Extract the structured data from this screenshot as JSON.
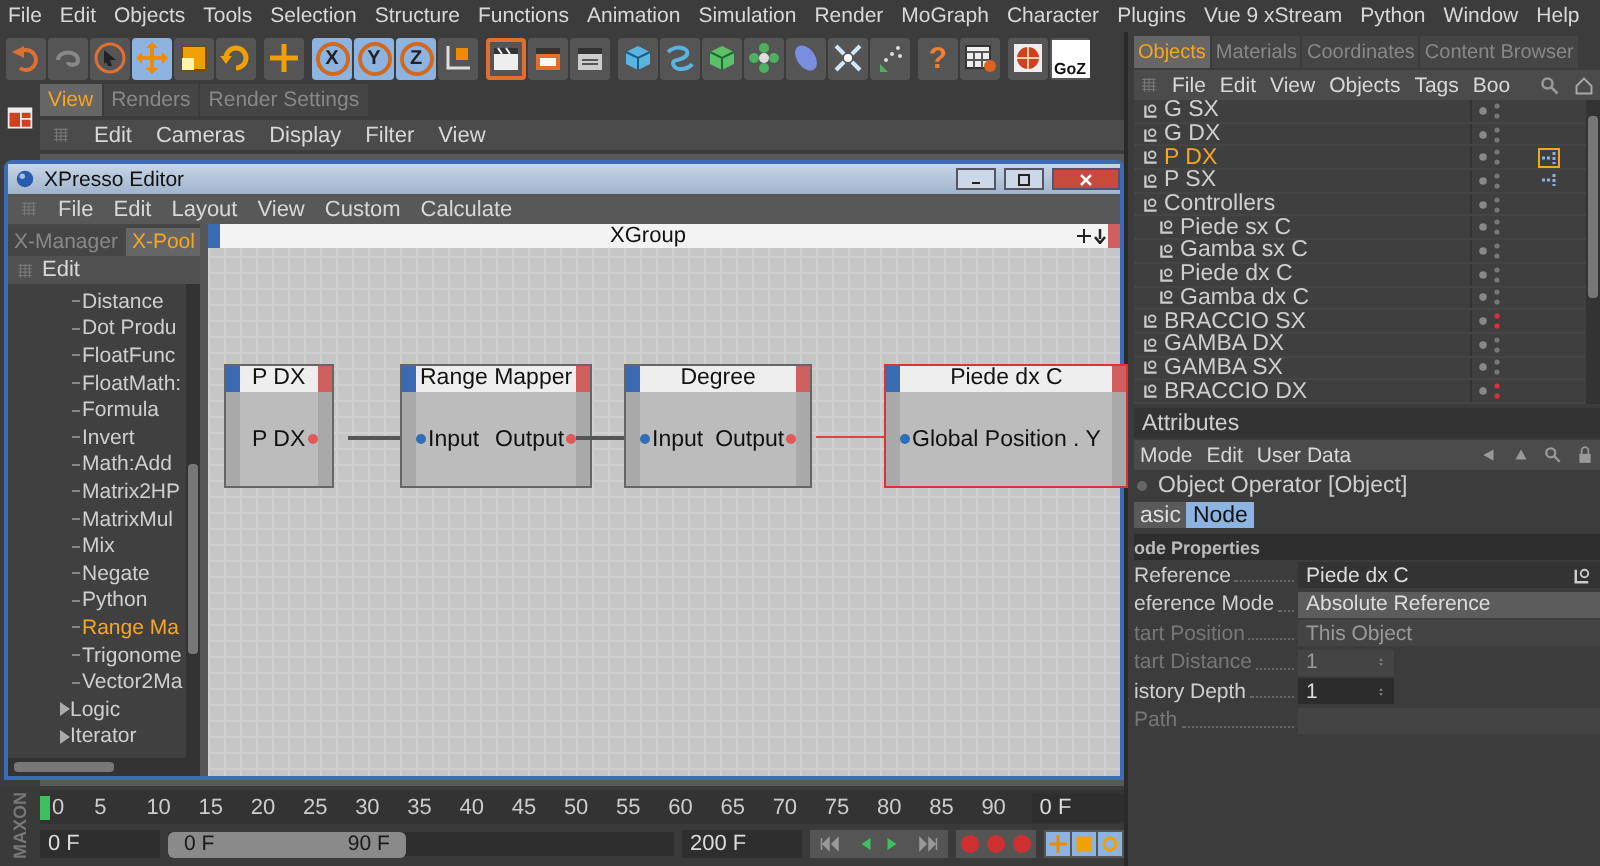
{
  "menu_bar": [
    "File",
    "Edit",
    "Objects",
    "Tools",
    "Selection",
    "Structure",
    "Functions",
    "Animation",
    "Simulation",
    "Render",
    "MoGraph",
    "Character",
    "Plugins",
    "Vue 9 xStream",
    "Python",
    "Window",
    "Help"
  ],
  "toolbar": [
    [
      {
        "kind": "undo",
        "active": false
      },
      {
        "kind": "redo",
        "active": false
      },
      {
        "kind": "select",
        "active": false
      },
      {
        "kind": "move",
        "active": true
      },
      {
        "kind": "scale",
        "active": false
      },
      {
        "kind": "rotate",
        "active": false
      }
    ],
    [
      {
        "kind": "add",
        "active": false
      }
    ],
    [
      {
        "kind": "axis",
        "label": "X",
        "active": true
      },
      {
        "kind": "axis",
        "label": "Y",
        "active": true
      },
      {
        "kind": "axis",
        "label": "Z",
        "active": true
      },
      {
        "kind": "coords",
        "active": false
      }
    ],
    [
      {
        "kind": "render_view",
        "active": true
      },
      {
        "kind": "render_picture",
        "active": false
      },
      {
        "kind": "render_settings",
        "active": false
      }
    ],
    [
      {
        "kind": "cube",
        "active": false
      },
      {
        "kind": "spline",
        "active": false
      },
      {
        "kind": "nurbs",
        "active": false
      },
      {
        "kind": "array",
        "active": false
      },
      {
        "kind": "deformer",
        "active": false
      },
      {
        "kind": "scene",
        "active": false
      },
      {
        "kind": "particles",
        "active": false
      }
    ],
    [
      {
        "kind": "help",
        "label": "?",
        "active": false
      },
      {
        "kind": "layout",
        "active": false
      }
    ],
    [
      {
        "kind": "globe",
        "active": false
      },
      {
        "kind": "goz",
        "label": "GoZ",
        "active": false
      }
    ]
  ],
  "view_panel": {
    "tabs": [
      {
        "label": "View",
        "selected": true
      },
      {
        "label": "Renders",
        "selected": false
      },
      {
        "label": "Render Settings",
        "selected": false
      }
    ],
    "menu": [
      "Edit",
      "Cameras",
      "Display",
      "Filter",
      "View"
    ]
  },
  "xpresso_editor": {
    "title": "XPresso Editor",
    "menu": [
      "File",
      "Edit",
      "Layout",
      "View",
      "Custom",
      "Calculate"
    ],
    "tabs": [
      {
        "label": "X-Manager",
        "selected": false
      },
      {
        "label": "X-Pool",
        "selected": true
      }
    ],
    "pool_menu": [
      "Edit"
    ],
    "pool_items": [
      {
        "label": "Distance",
        "selected": false
      },
      {
        "label": "Dot Produ",
        "selected": false
      },
      {
        "label": "FloatFunc",
        "selected": false
      },
      {
        "label": "FloatMath:",
        "selected": false
      },
      {
        "label": "Formula",
        "selected": false
      },
      {
        "label": "Invert",
        "selected": false
      },
      {
        "label": "Math:Add",
        "selected": false
      },
      {
        "label": "Matrix2HP",
        "selected": false
      },
      {
        "label": "MatrixMul",
        "selected": false
      },
      {
        "label": "Mix",
        "selected": false
      },
      {
        "label": "Negate",
        "selected": false
      },
      {
        "label": "Python",
        "selected": false
      },
      {
        "label": "Range Ma",
        "selected": true
      },
      {
        "label": "Trigonome",
        "selected": false
      },
      {
        "label": "Vector2Ma",
        "selected": false
      }
    ],
    "pool_folders": [
      {
        "label": "Logic",
        "expanded": false
      },
      {
        "label": "Iterator",
        "expanded": false
      }
    ],
    "group_title": "XGroup",
    "nodes": [
      {
        "title": "P DX",
        "outputs": [
          "P DX"
        ],
        "selected": false
      },
      {
        "title": "Range Mapper",
        "inputs": [
          "Input"
        ],
        "outputs": [
          "Output"
        ],
        "selected": false
      },
      {
        "title": "Degree",
        "inputs": [
          "Input"
        ],
        "outputs": [
          "Output"
        ],
        "selected": false
      },
      {
        "title": "Piede dx C",
        "inputs": [
          "Global Position . Y"
        ],
        "selected": true
      }
    ],
    "links": [
      {
        "selected": false
      },
      {
        "selected": false
      },
      {
        "selected": true
      }
    ]
  },
  "objects_panel": {
    "tabs": [
      {
        "label": "Objects",
        "selected": true
      },
      {
        "label": "Materials",
        "selected": false
      },
      {
        "label": "Coordinates",
        "selected": false
      },
      {
        "label": "Content Browser",
        "selected": false
      }
    ],
    "menu": [
      "File",
      "Edit",
      "View",
      "Objects",
      "Tags",
      "Boo"
    ],
    "items": [
      {
        "name": "G SX",
        "selected": false,
        "tag": false,
        "hidden": false
      },
      {
        "name": "G DX",
        "selected": false,
        "tag": false,
        "hidden": false
      },
      {
        "name": "P DX",
        "selected": true,
        "tag": true,
        "hidden": false
      },
      {
        "name": "P SX",
        "selected": false,
        "tag": true,
        "hidden": false
      },
      {
        "name": "Controllers",
        "selected": false,
        "tag": false,
        "hidden": false,
        "children": [
          {
            "name": "Piede sx C",
            "selected": false,
            "tag": false,
            "hidden": false
          },
          {
            "name": "Gamba sx C",
            "selected": false,
            "tag": false,
            "hidden": false
          },
          {
            "name": "Piede dx C",
            "selected": false,
            "tag": false,
            "hidden": false
          },
          {
            "name": "Gamba dx C",
            "selected": false,
            "tag": false,
            "hidden": false
          }
        ]
      },
      {
        "name": "BRACCIO SX",
        "selected": false,
        "tag": false,
        "hidden": true
      },
      {
        "name": "GAMBA DX",
        "selected": false,
        "tag": false,
        "hidden": false
      },
      {
        "name": "GAMBA SX",
        "selected": false,
        "tag": false,
        "hidden": false
      },
      {
        "name": "BRACCIO DX",
        "selected": false,
        "tag": false,
        "hidden": true
      }
    ]
  },
  "attributes_panel": {
    "title": "Attributes",
    "menu": [
      "Mode",
      "Edit",
      "User Data"
    ],
    "object_title": "Object Operator [Object]",
    "tabs": [
      {
        "label": "asic",
        "selected": false
      },
      {
        "label": "Node",
        "selected": true
      }
    ],
    "section": "ode Properties",
    "properties": [
      {
        "label": "Reference",
        "kind": "link",
        "value": "Piede dx C",
        "disabled": false
      },
      {
        "label": "eference Mode",
        "kind": "dropdown",
        "value": "Absolute Reference",
        "disabled": false
      },
      {
        "label": "tart Position",
        "kind": "dropdown",
        "value": "This Object",
        "disabled": true
      },
      {
        "label": "tart Distance",
        "kind": "number",
        "value": "1",
        "disabled": true
      },
      {
        "label": "istory Depth",
        "kind": "number",
        "value": "1",
        "disabled": false
      },
      {
        "label": "Path",
        "kind": "text",
        "disabled": true
      }
    ]
  },
  "timeline": {
    "logo": "MAXON",
    "ticks": [
      {
        "label": "0",
        "current": true
      },
      {
        "label": "5",
        "current": false
      },
      {
        "label": "10",
        "current": false
      },
      {
        "label": "15",
        "current": false
      },
      {
        "label": "20",
        "current": false
      },
      {
        "label": "25",
        "current": false
      },
      {
        "label": "30",
        "current": false
      },
      {
        "label": "35",
        "current": false
      },
      {
        "label": "40",
        "current": false
      },
      {
        "label": "45",
        "current": false
      },
      {
        "label": "50",
        "current": false
      },
      {
        "label": "55",
        "current": false
      },
      {
        "label": "60",
        "current": false
      },
      {
        "label": "65",
        "current": false
      },
      {
        "label": "70",
        "current": false
      },
      {
        "label": "75",
        "current": false
      },
      {
        "label": "80",
        "current": false
      },
      {
        "label": "85",
        "current": false
      },
      {
        "label": "90",
        "current": false
      }
    ],
    "current_field": "0 F",
    "start_field": "0 F",
    "range_start": "0 F",
    "range_end": "90 F",
    "level": 0.47,
    "end_field": "200 F"
  }
}
